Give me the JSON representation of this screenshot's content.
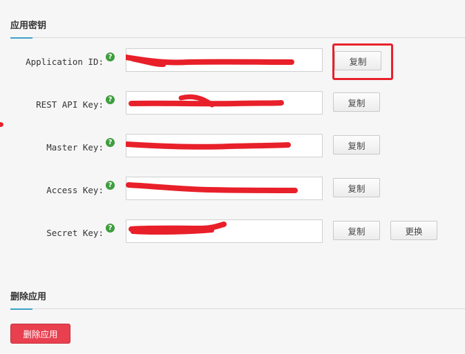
{
  "app_keys_section": {
    "title": "应用密钥",
    "rows": [
      {
        "label": "Application ID:",
        "value": "",
        "copy_label": "复制"
      },
      {
        "label": "REST API Key:",
        "value": "",
        "copy_label": "复制"
      },
      {
        "label": "Master Key:",
        "value": "",
        "copy_label": "复制"
      },
      {
        "label": "Access Key:",
        "value": "",
        "copy_label": "复制"
      },
      {
        "label": "Secret Key:",
        "value": "",
        "copy_label": "复制",
        "reset_label": "更换"
      }
    ],
    "help_icon": {
      "name": "help-icon",
      "glyph": "?"
    }
  },
  "delete_section": {
    "title": "删除应用",
    "delete_label": "删除应用"
  },
  "colors": {
    "accent": "#3aa0c8",
    "help_icon": "#3f9e3f",
    "danger": "#e8404f",
    "annotation_red": "#e8202a"
  }
}
